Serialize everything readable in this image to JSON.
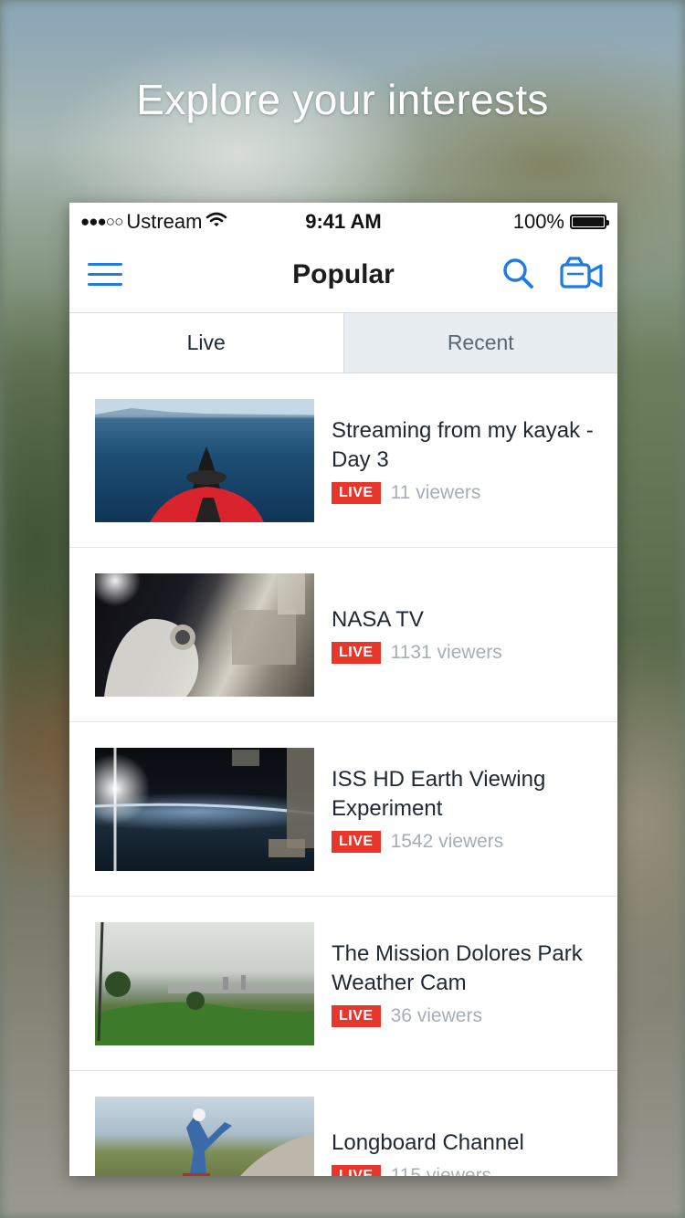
{
  "headline": "Explore your interests",
  "status_bar": {
    "carrier": "Ustream",
    "signal": "●●●○○",
    "time": "9:41 AM",
    "battery": "100%",
    "battery_level": 1.0
  },
  "nav": {
    "title": "Popular",
    "menu_icon": "hamburger-menu-icon",
    "search_icon": "search-icon",
    "camera_icon": "video-camera-icon"
  },
  "tabs": [
    {
      "label": "Live",
      "selected": true
    },
    {
      "label": "Recent",
      "selected": false
    }
  ],
  "streams": [
    {
      "title": "Streaming from my kayak - Day 3",
      "badge": "LIVE",
      "viewers": "11 viewers"
    },
    {
      "title": "NASA TV",
      "badge": "LIVE",
      "viewers": "1131 viewers"
    },
    {
      "title": "ISS HD Earth Viewing Experiment",
      "badge": "LIVE",
      "viewers": "1542 viewers"
    },
    {
      "title": "The Mission Dolores Park Weather Cam",
      "badge": "LIVE",
      "viewers": "36 viewers"
    },
    {
      "title": "Longboard Channel",
      "badge": "LIVE",
      "viewers": "115 viewers"
    }
  ],
  "colors": {
    "accent": "#1f7be0",
    "live_badge": "#e8362a",
    "viewers_text": "#a5aeb8"
  }
}
